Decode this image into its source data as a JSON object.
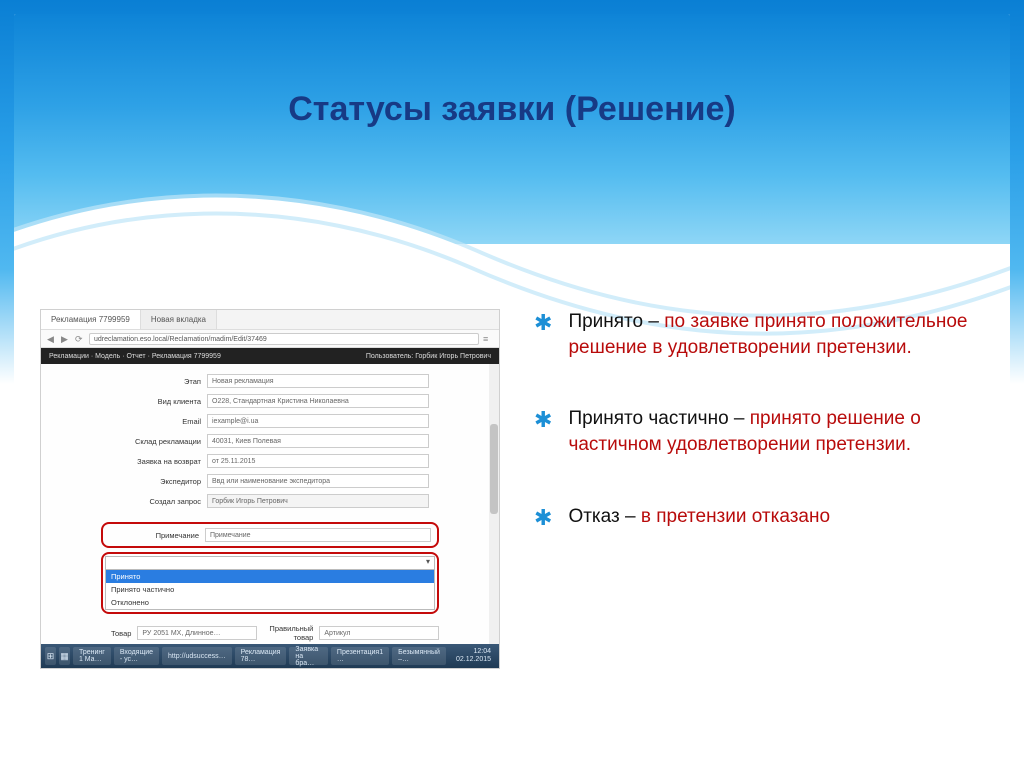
{
  "slide": {
    "title": "Статусы заявки (Решение)"
  },
  "bullets": [
    {
      "term": "Принято",
      "sep": " – ",
      "rest": "по заявке принято положительное решение в удовлетворении претензии."
    },
    {
      "term": "Принято частично",
      "sep": " – ",
      "rest": "принято решение о частичном удовлетворении претензии."
    },
    {
      "term": "Отказ",
      "sep": " – ",
      "rest": "в претензии отказано"
    }
  ],
  "app": {
    "tabs": [
      "Рекламация 7799959",
      "Новая вкладка"
    ],
    "url": "udreclamation.eso.local/Reclamation/madim/Edit/37469",
    "dark_left": "Рекламации · Модель · Отчет · Рекламация 7799959",
    "dark_right": "Пользователь: Горбик Игорь Петрович",
    "form": {
      "rows": [
        {
          "label": "Этап",
          "value": "Новая рекламация"
        },
        {
          "label": "Вид клиента",
          "value": "О228, Стандартная Кристина Николаевна"
        },
        {
          "label": "Email",
          "value": "iexample@i.ua"
        },
        {
          "label": "Склад рекламации",
          "value": "40031, Киев Полевая"
        },
        {
          "label": "Заявка на возврат",
          "value": "от 25.11.2015"
        },
        {
          "label": "Экспедитор",
          "value": "Ввд или наименование экспедитора"
        },
        {
          "label": "Создал запрос",
          "value": "Горбик Игорь Петрович"
        }
      ],
      "decision_label": "Примечание",
      "decision_value": "Примечание",
      "dropdown": [
        "Принято",
        "Принято частично",
        "Отклонено"
      ],
      "bottom_left_label": "Товар",
      "bottom_left_value": "РУ 2051 МХ, Длинное…",
      "bottom_right_label": "Правильный товар",
      "bottom_right_value": "Артикул"
    },
    "taskbar": {
      "items": [
        "Тренинг 1 Ма…",
        "Входящие - ус…",
        "http://udsuccess…",
        "Рекламация 78…",
        "Заявка на бра…",
        "Презентация1 …",
        "Безымянный –…"
      ],
      "time": "12:04",
      "date": "02.12.2015"
    }
  }
}
